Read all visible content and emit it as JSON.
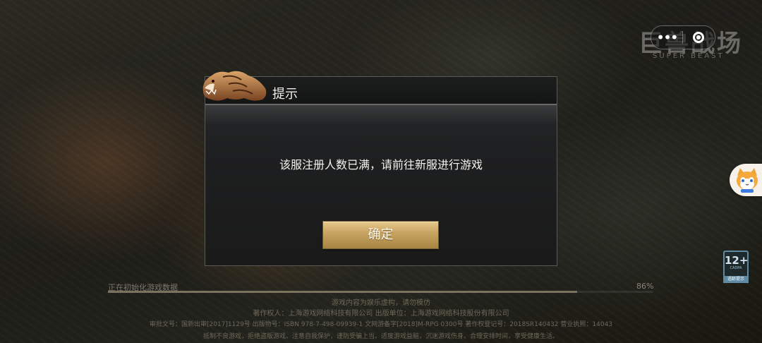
{
  "logo": {
    "title": "巨兽战场",
    "subtitle": "SUPER BEAST"
  },
  "mini_program_capsule": {
    "more_label": "•••",
    "close_label": ""
  },
  "dialog": {
    "title": "提示",
    "message": "该服注册人数已满，请前往新服进行游戏",
    "confirm_label": "确定"
  },
  "loading": {
    "text": "正在初始化游戏数据",
    "percent_text": "86%",
    "progress": 0.86
  },
  "age_rating": {
    "age": "12+",
    "org": "CADPA",
    "label": "适龄提示"
  },
  "footer": {
    "line1": "游戏内容为娱乐虚构，请勿模仿",
    "line2": "著作权人：上海游戏网络科技有限公司     出版单位：上海游戏网络科技股份有限公司",
    "line3": "审批文号：国新出审[2017]1129号    出版物号：ISBN 978-7-498-09939-1    文网游备字[2018]M-RPG 0300号    著作权登记号：2018SR140432    营业执照：14043",
    "line4": "抵制不良游戏，拒绝盗版游戏。注意自我保护，谨防受骗上当。适度游戏益脑，沉迷游戏伤身。合理安排时间，享受健康生活。"
  },
  "colors": {
    "accent_gold": "#c9a563",
    "dialog_bg": "#1e1f20",
    "text_light": "#f4f2ec"
  }
}
